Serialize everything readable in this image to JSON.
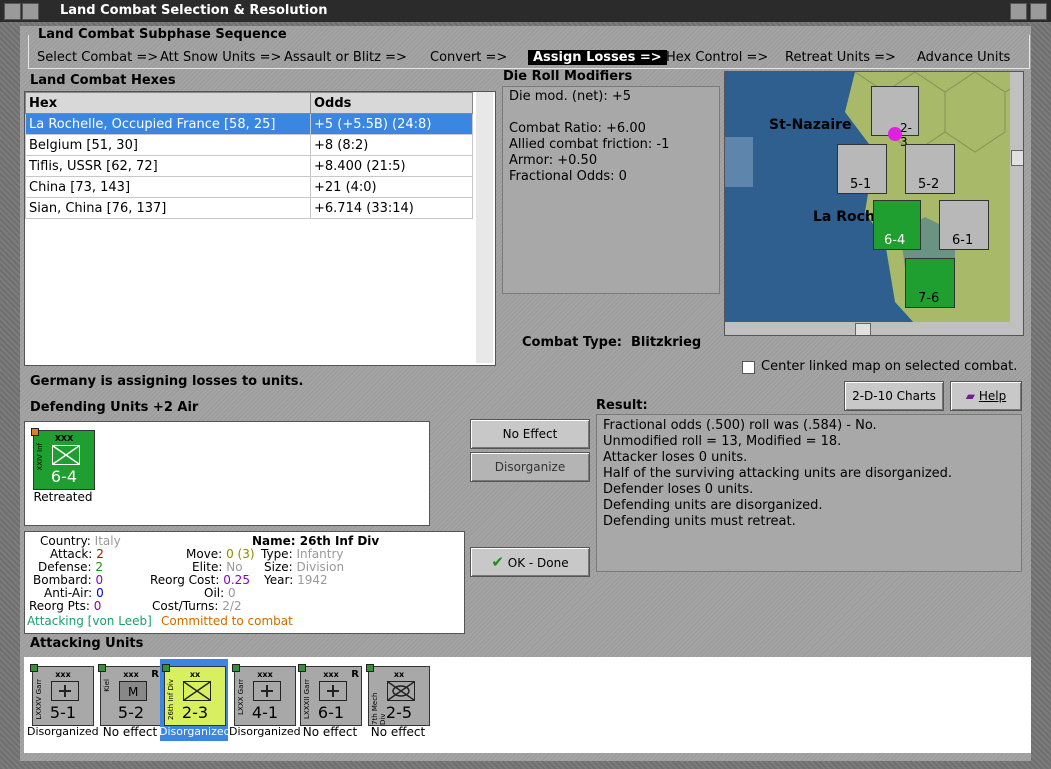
{
  "window": {
    "title": "Land Combat Selection & Resolution"
  },
  "sequence": {
    "title": "Land Combat Subphase Sequence",
    "items": [
      "Select Combat =>",
      "Att Snow Units =>",
      "Assault or Blitz =>",
      "Convert =>",
      "Assign Losses =>",
      "Hex Control =>",
      "Retreat Units =>",
      "Advance Units"
    ],
    "active": "Assign Losses =>"
  },
  "hexes": {
    "title": "Land Combat Hexes",
    "columns": [
      "Hex",
      "Odds"
    ],
    "rows": [
      {
        "hex": "La Rochelle, Occupied France [58, 25]",
        "odds": "+5 (+5.5B) (24:8)"
      },
      {
        "hex": "Belgium [51, 30]",
        "odds": "+8 (8:2)"
      },
      {
        "hex": "Tiflis, USSR [62, 72]",
        "odds": "+8.400 (21:5)"
      },
      {
        "hex": "China [73, 143]",
        "odds": "+21 (4:0)"
      },
      {
        "hex": "Sian, China [76, 137]",
        "odds": "+6.714 (33:14)"
      }
    ]
  },
  "modifiers": {
    "title": "Die Roll Modifiers",
    "lines": [
      "Die mod. (net): +5",
      "",
      "Combat Ratio: +6.00",
      "Allied combat friction: -1",
      "Armor: +0.50",
      "Fractional Odds: 0"
    ]
  },
  "combat_type": {
    "label": "Combat Type:",
    "value": "Blitzkrieg"
  },
  "map": {
    "labels": [
      "St-Nazaire",
      "La Roch"
    ],
    "counters": [
      "5-1",
      "5-2",
      "6-4",
      "6-1",
      "7-6",
      "2-3"
    ],
    "checkbox_label": "Center linked map on selected combat."
  },
  "status_message": "Germany is assigning losses to units.",
  "defending": {
    "title": "Defending Units +2 Air",
    "unit": {
      "value": "6-4",
      "status": "Retreated",
      "side": "XXIV Inf"
    }
  },
  "buttons": {
    "no_effect": "No Effect",
    "disorganize": "Disorganize",
    "ok_done": "OK - Done",
    "charts": "2-D-10 Charts",
    "help": "Help"
  },
  "result": {
    "title": "Result:",
    "lines": [
      "Fractional odds (.500) roll was (.584)  - No.",
      "Unmodified roll = 13, Modified = 18.",
      "Attacker loses 0 units.",
      "Half of the surviving attacking units are disorganized.",
      "Defender loses 0 units.",
      "Defending units are disorganized.",
      "Defending units must retreat."
    ]
  },
  "unit_info": {
    "country_label": "Country:",
    "country": "Italy",
    "name_label": "Name:",
    "name": "26th Inf Div",
    "attack_label": "Attack:",
    "attack": "2",
    "defense_label": "Defense:",
    "defense": "2",
    "bombard_label": "Bombard:",
    "bombard": "0",
    "antiair_label": "Anti-Air:",
    "antiair": "0",
    "reorg_label": "Reorg Pts:",
    "reorg": "0",
    "move_label": "Move:",
    "move": "0 (3)",
    "elite_label": "Elite:",
    "elite": "No",
    "reorg_cost_label": "Reorg Cost:",
    "reorg_cost": "0.25",
    "oil_label": "Oil:",
    "oil": "0",
    "cost_turns_label": "Cost/Turns:",
    "cost_turns": "2/2",
    "type_label": "Type:",
    "type": "Infantry",
    "size_label": "Size:",
    "size": "Division",
    "year_label": "Year:",
    "year": "1942",
    "attacking_note": "Attacking [von Leeb]",
    "committed_note": "Committed to combat"
  },
  "attacking": {
    "title": "Attacking Units",
    "units": [
      {
        "value": "5-1",
        "status": "Disorganized",
        "side": "LXXXV Garr",
        "size": "xxx"
      },
      {
        "value": "5-2",
        "status": "No effect",
        "side": "Kiel",
        "size": "xxx"
      },
      {
        "value": "2-3",
        "status": "Disorganized",
        "side": "26th Inf Div",
        "size": "xx"
      },
      {
        "value": "4-1",
        "status": "Disorganized",
        "side": "LXXX Garr",
        "size": "xxx"
      },
      {
        "value": "6-1",
        "status": "No effect",
        "side": "LXXXII Garr",
        "size": "xxx"
      },
      {
        "value": "2-5",
        "status": "No effect",
        "side": "7th Mech Div",
        "size": "xx"
      }
    ]
  },
  "colors": {
    "selection": "#3b86e0",
    "friendly_green": "#1f9f2f",
    "highlight_yellow": "#d8f060"
  }
}
